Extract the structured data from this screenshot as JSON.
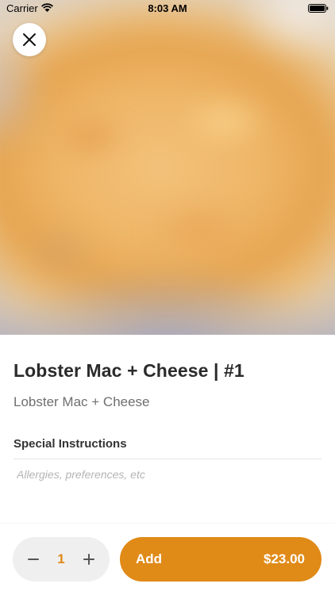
{
  "status_bar": {
    "carrier": "Carrier",
    "time": "8:03 AM",
    "wifi_icon": "wifi-icon",
    "battery_icon": "battery-icon"
  },
  "header": {
    "close_icon": "close-icon"
  },
  "item": {
    "title": "Lobster Mac + Cheese | #1",
    "description": "Lobster Mac + Cheese"
  },
  "instructions": {
    "label": "Special Instructions",
    "placeholder": "Allergies, preferences, etc",
    "value": ""
  },
  "order_bar": {
    "minus_icon": "minus-icon",
    "plus_icon": "plus-icon",
    "quantity": "1",
    "add_label": "Add",
    "price": "$23.00"
  },
  "colors": {
    "accent": "#e08a17",
    "stepper_bg": "#efefef",
    "title": "#2b2b2b",
    "subtitle": "#6f6f6f"
  }
}
